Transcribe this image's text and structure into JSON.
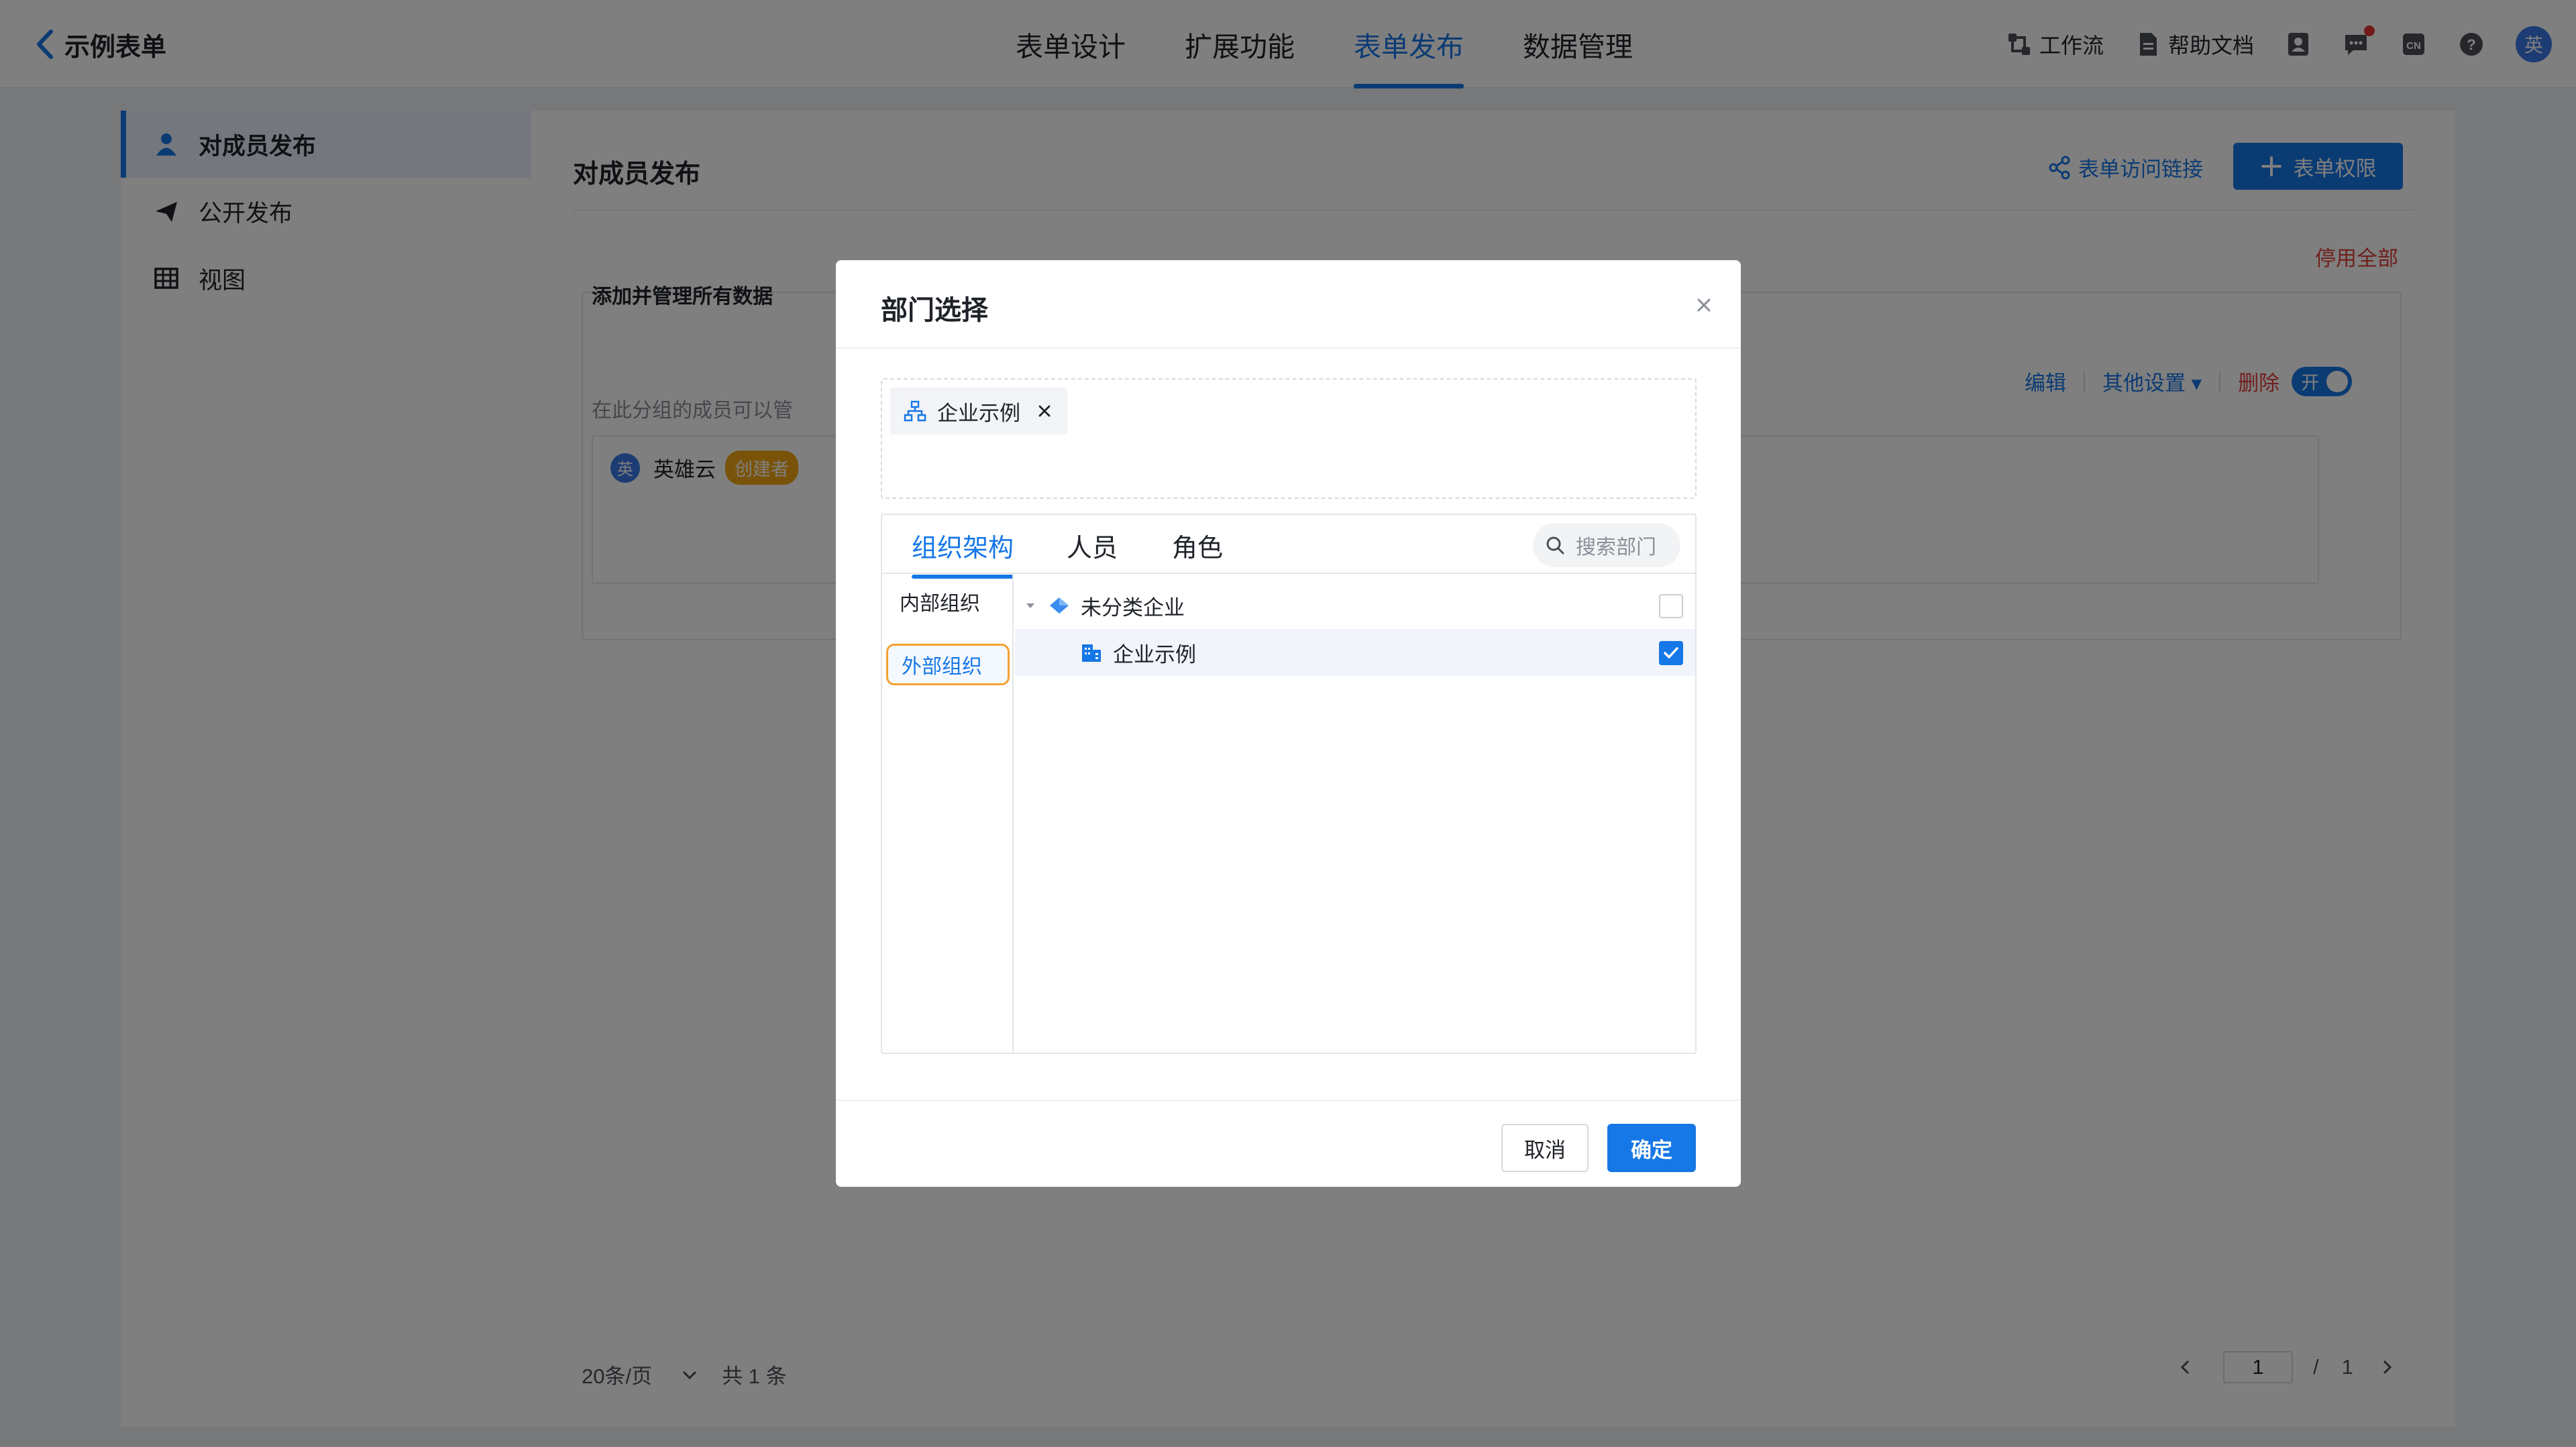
{
  "app": {
    "back_label": "示例表单"
  },
  "nav": {
    "tabs": [
      {
        "label": "表单设计"
      },
      {
        "label": "扩展功能"
      },
      {
        "label": "表单发布",
        "active": true
      },
      {
        "label": "数据管理"
      }
    ]
  },
  "toolbar": {
    "workflow": "工作流",
    "help_docs": "帮助文档",
    "avatar": "英"
  },
  "sidebar": {
    "items": [
      {
        "label": "对成员发布",
        "icon": "user-icon",
        "active": true
      },
      {
        "label": "公开发布",
        "icon": "send-icon"
      },
      {
        "label": "视图",
        "icon": "table-icon"
      }
    ]
  },
  "main": {
    "title": "对成员发布",
    "access_link": "表单访问链接",
    "permission_button": "表单权限",
    "disable_all": "停用全部",
    "group": {
      "title": "添加并管理所有数据",
      "subtitle": "在此分组的成员可以管",
      "actions": {
        "edit": "编辑",
        "other": "其他设置",
        "delete": "删除",
        "switch": "开"
      },
      "member": {
        "avatar": "英",
        "name": "英雄云",
        "tag": "创建者"
      }
    },
    "pager": {
      "page_size": "20条/页",
      "total": "共 1 条",
      "current": "1",
      "slash": "/",
      "pages": "1"
    }
  },
  "modal": {
    "title": "部门选择",
    "selected": [
      {
        "label": "企业示例"
      }
    ],
    "tabs": [
      {
        "label": "组织架构",
        "active": true
      },
      {
        "label": "人员"
      },
      {
        "label": "角色"
      }
    ],
    "search_placeholder": "搜索部门",
    "org_types": [
      {
        "label": "内部组织"
      },
      {
        "label": "外部组织",
        "selected": true
      }
    ],
    "tree": [
      {
        "label": "未分类企业",
        "checked": false,
        "level": 0
      },
      {
        "label": "企业示例",
        "checked": true,
        "level": 1
      }
    ],
    "cancel": "取消",
    "confirm": "确定"
  },
  "colors": {
    "primary": "#1677e6",
    "danger": "#e0413a",
    "warning": "#f3a712"
  }
}
